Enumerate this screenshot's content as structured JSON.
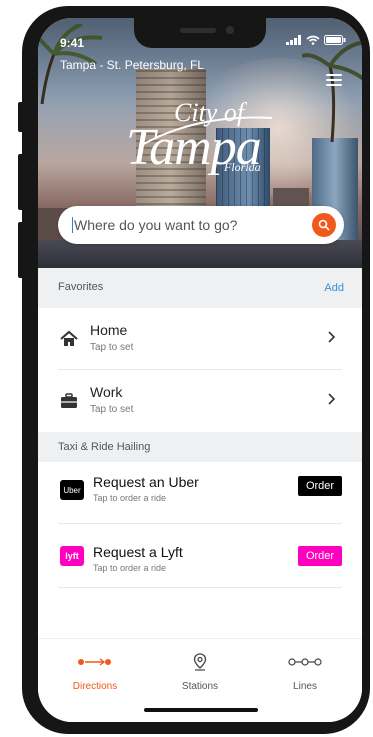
{
  "status_bar": {
    "time": "9:41"
  },
  "header": {
    "location": "Tampa - St. Petersburg, FL",
    "logo": {
      "city": "City of",
      "name": "Tampa",
      "region": "Florida"
    }
  },
  "search": {
    "placeholder": "Where do you want to go?"
  },
  "favorites": {
    "title": "Favorites",
    "add_label": "Add",
    "items": [
      {
        "title": "Home",
        "subtitle": "Tap to set",
        "icon": "home-icon"
      },
      {
        "title": "Work",
        "subtitle": "Tap to set",
        "icon": "briefcase-icon"
      }
    ]
  },
  "rides": {
    "title": "Taxi & Ride Hailing",
    "items": [
      {
        "logo_text": "Uber",
        "title": "Request an Uber",
        "subtitle": "Tap to order a ride",
        "button": "Order",
        "color": "#000000"
      },
      {
        "logo_text": "lyft",
        "title": "Request a Lyft",
        "subtitle": "Tap to order a ride",
        "button": "Order",
        "color": "#ff00bf"
      }
    ]
  },
  "tabs": [
    {
      "label": "Directions",
      "icon": "directions-icon",
      "active": true
    },
    {
      "label": "Stations",
      "icon": "location-pin-icon",
      "active": false
    },
    {
      "label": "Lines",
      "icon": "lines-icon",
      "active": false
    }
  ],
  "colors": {
    "accent": "#ef5a1c",
    "link": "#3a8fd8",
    "lyft": "#ff00bf",
    "uber": "#000000",
    "section_bg": "#eef0f2"
  }
}
